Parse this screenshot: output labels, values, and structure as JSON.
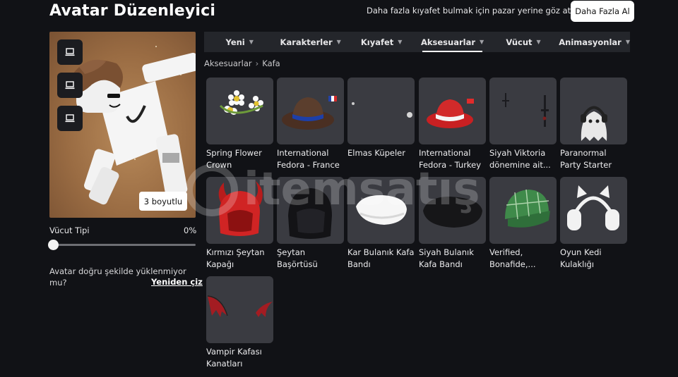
{
  "header": {
    "title": "Avatar Düzenleyici",
    "promo_text": "Daha fazla kıyafet bulmak için pazar yerine göz at!",
    "promo_button": "Daha Fazla Al"
  },
  "preview": {
    "view_buttons": [
      {
        "icon": "monitor-icon"
      },
      {
        "icon": "monitor-icon"
      },
      {
        "icon": "monitor-icon"
      }
    ],
    "toggle_3d_label": "3 boyutlu"
  },
  "body_type": {
    "label": "Vücut Tipi",
    "value_text": "0%",
    "value": 0
  },
  "warning": {
    "text": "Avatar doğru şekilde yüklenmiyor mu?",
    "redraw_label": "Yeniden çiz"
  },
  "tabs": [
    {
      "label": "Yeni",
      "active": false
    },
    {
      "label": "Karakterler",
      "active": false
    },
    {
      "label": "Kıyafet",
      "active": false
    },
    {
      "label": "Aksesuarlar",
      "active": true
    },
    {
      "label": "Vücut",
      "active": false
    },
    {
      "label": "Animasyonlar",
      "active": false
    }
  ],
  "breadcrumb": [
    "Aksesuarlar",
    "Kafa"
  ],
  "items": [
    {
      "name": "Spring Flower Crown",
      "icon": "flower-crown-icon"
    },
    {
      "name": "International Fedora - France",
      "icon": "fedora-france-icon"
    },
    {
      "name": "Elmas Küpeler",
      "icon": "earrings-icon"
    },
    {
      "name": "International Fedora - Turkey",
      "icon": "fedora-turkey-icon"
    },
    {
      "name": "Siyah Viktoria dönemine ait...",
      "icon": "victorian-earrings-icon"
    },
    {
      "name": "Paranormal Party Starter",
      "icon": "ghost-headphones-icon"
    },
    {
      "name": "Kırmızı Şeytan Kapağı",
      "icon": "red-devil-hood-icon"
    },
    {
      "name": "Şeytan Başörtüsü",
      "icon": "black-devil-hood-icon"
    },
    {
      "name": "Kar Bulanık Kafa Bandı",
      "icon": "white-headband-icon"
    },
    {
      "name": "Siyah Bulanık Kafa Bandı",
      "icon": "black-headband-icon"
    },
    {
      "name": "Verified, Bonafide,...",
      "icon": "plaid-cap-icon"
    },
    {
      "name": "Oyun Kedi Kulaklığı",
      "icon": "cat-headphones-icon"
    },
    {
      "name": "Vampir Kafası Kanatları",
      "icon": "vampire-wings-icon"
    }
  ],
  "watermark": "itemsatış",
  "colors": {
    "background": "#111216",
    "tab_bar": "#24262b",
    "card": "#3a3b41",
    "accent_white": "#ffffff"
  }
}
